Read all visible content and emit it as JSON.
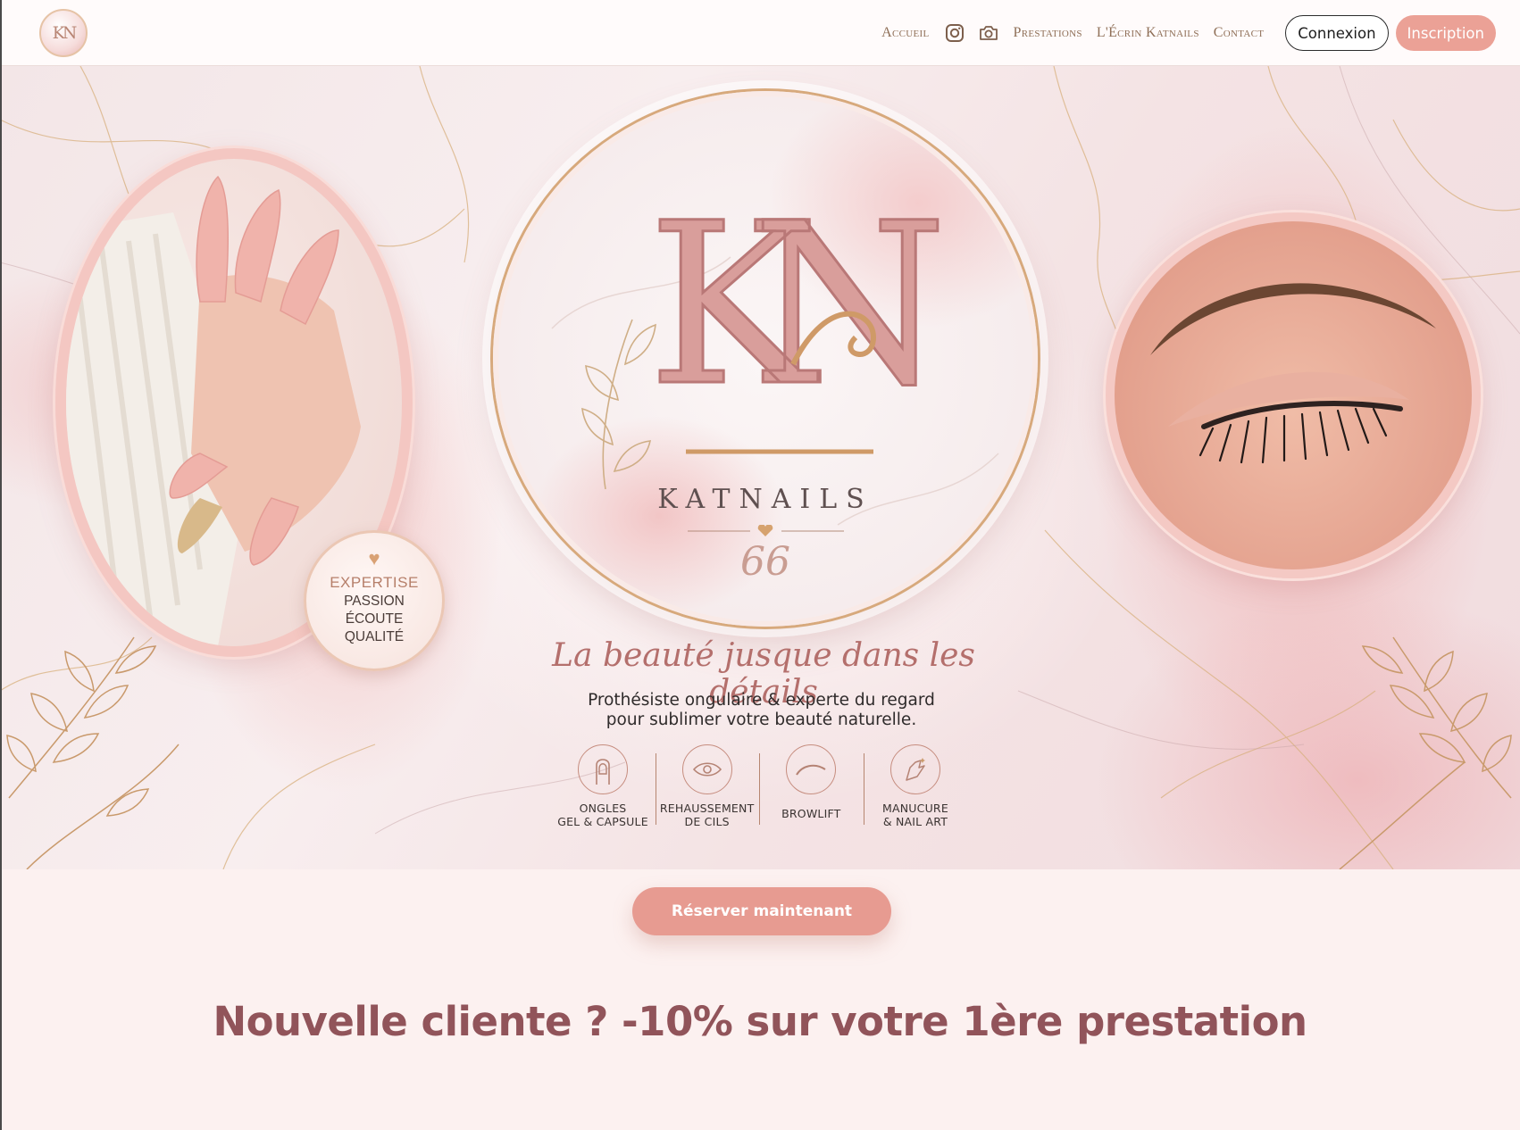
{
  "header": {
    "logo_monogram": "KN",
    "nav": [
      {
        "label": "Accueil"
      },
      {
        "icon": "instagram-icon"
      },
      {
        "icon": "camera-icon"
      },
      {
        "label": "Prestations"
      },
      {
        "label": "L'Écrin Katnails"
      },
      {
        "label": "Contact"
      }
    ],
    "login_label": "Connexion",
    "signup_label": "Inscription"
  },
  "hero": {
    "logo_letters": "KN",
    "brand_name": "KATNAILS",
    "brand_number": "66",
    "tagline": "La beauté jusque dans les détails",
    "subtitle_line1": "Prothésiste ongulaire & experte du regard",
    "subtitle_line2": "pour sublimer votre beauté naturelle.",
    "badge": {
      "line1": "EXPERTISE",
      "line2": "PASSION",
      "line3": "ÉCOUTE",
      "line4": "QUALITÉ"
    },
    "services": [
      {
        "icon": "nail-icon",
        "line1": "ONGLES",
        "line2": "GEL & CAPSULE"
      },
      {
        "icon": "eye-icon",
        "line1": "REHAUSSEMENT",
        "line2": "DE CILS"
      },
      {
        "icon": "brow-icon",
        "line1": "BROWLIFT",
        "line2": ""
      },
      {
        "icon": "hand-icon",
        "line1": "MANUCURE",
        "line2": "& NAIL ART"
      }
    ]
  },
  "cta_label": "Réserver maintenant",
  "promo_text": "Nouvelle cliente ? -10% sur votre 1ère prestation",
  "colors": {
    "accent": "#eba196",
    "promo": "#91545a",
    "nav_text": "#8f6f57"
  }
}
